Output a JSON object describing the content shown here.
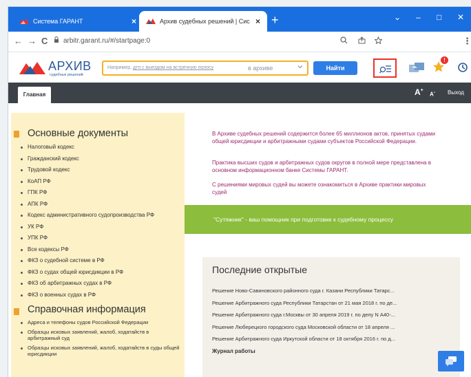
{
  "browser": {
    "tabs": [
      {
        "title": "Система ГАРАНТ",
        "close": "×"
      },
      {
        "title": "Архив судебных решений | Сис",
        "close": "×"
      }
    ],
    "new_tab": "+",
    "window_controls": {
      "expand": "⌄",
      "minimize": "–",
      "maximize": "□",
      "close": "✕"
    },
    "url": "arbitr.garant.ru/#/startpage:0",
    "nav": {
      "back": "←",
      "forward": "→",
      "reload": "C",
      "menu": "⋮"
    }
  },
  "site": {
    "logo_text": "АРХИВ",
    "logo_sub": "судебных решений",
    "search": {
      "placeholder_prefix": "Например, ",
      "placeholder_link": "дтп с выездом на встречную полосу",
      "scope": "в архиве",
      "button": "Найти"
    },
    "nav_tab": "Главная",
    "font_up": "A",
    "font_up_sup": "+",
    "font_down": "A",
    "font_down_sup": "-",
    "logout": "Выход",
    "notification_badge": "!",
    "colors": {
      "accent_blue": "#2f7ee6",
      "orange": "#f5b021",
      "red": "#e8322c",
      "green": "#8cbd3c",
      "magenta_text": "#9c2a6e"
    }
  },
  "left": {
    "main_title": "Основные документы",
    "main_docs": [
      "Налоговый кодекс",
      "Гражданский кодекс",
      "Трудовой кодекс",
      "КоАП РФ",
      "ГПК РФ",
      "АПК РФ",
      "Кодекс административного судопроизводства РФ",
      "УК РФ",
      "УПК РФ",
      "Все кодексы РФ",
      "ФКЗ о судебной системе в РФ",
      "ФКЗ о судах общей юрисдикции в РФ",
      "ФКЗ об арбитражных судах в РФ",
      "ФКЗ о военных судах в РФ"
    ],
    "ref_title": "Справочная информация",
    "ref_docs": [
      "Адреса и телефоны судов Российской Федерации",
      "Образцы исковых заявлений, жалоб, ходатайств в арбитражный суд",
      "Образцы исковых заявлений, жалоб, ходатайств в суды общей юрисдикции"
    ]
  },
  "info": {
    "p1": "В Архиве судебных решений содержится более 65 миллионов актов, принятых судами общей юрисдикции и арбитражными судами субъектов Российской Федерации.",
    "p2": "Практика высших судов и арбитражных судов округов в полной мере представлена в основном информационном банке Системы ГАРАНТ.",
    "p3": "С решениями мировых судей вы можете ознакомиться в Архиве практики мировых судей"
  },
  "banner": "\"Сутяжник\" - ваш помощник при подготовке к судебному процессу",
  "recent": {
    "title": "Последние открытые",
    "items": [
      "Решение Ново-Савиновского районного суда г. Казани Республики Татарс...",
      "Решение Арбитражного суда Республики Татарстан от 21 мая 2018 г. по де...",
      "Решение Арбитражного суда г.Москвы от 30 апреля 2019 г. по делу N А40-...",
      "Решение Люберецкого городского суда Московской области от 18 апреля ...",
      "Решение Арбитражного суда Иркутской области от 18 октября 2016 г. по д..."
    ],
    "journal": "Журнал работы"
  }
}
